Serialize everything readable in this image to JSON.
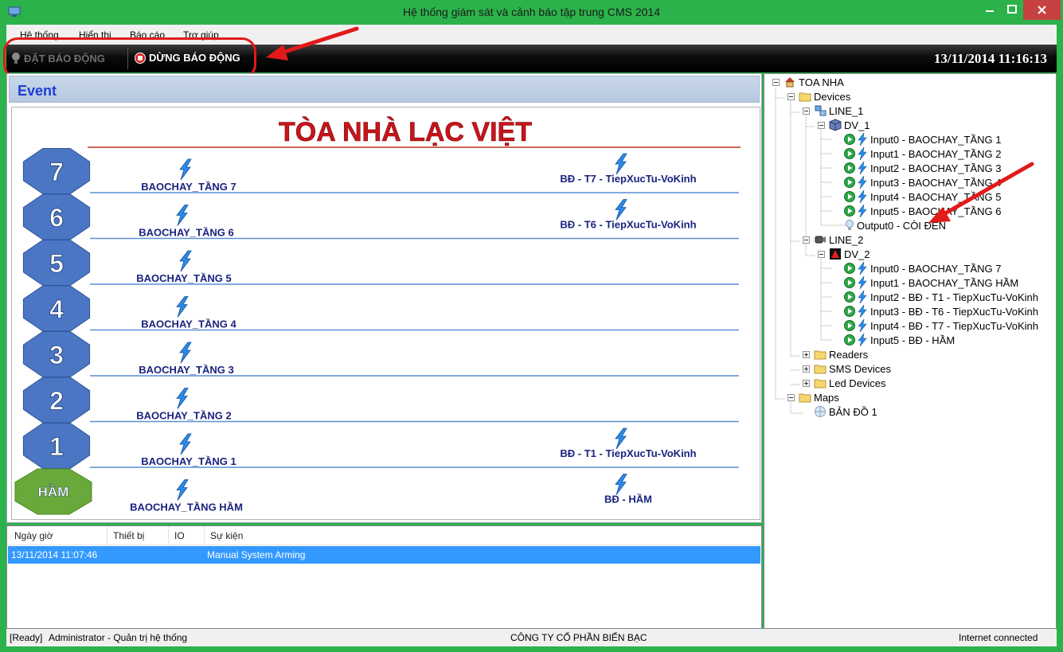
{
  "window": {
    "title": "Hệ thống giám sát và cảnh báo tập trung CMS 2014"
  },
  "menu": {
    "items": [
      "Hệ thống",
      "Hiển thị",
      "Báo cáo",
      "Trợ giúp"
    ]
  },
  "toolbar": {
    "arm_label": "ĐẶT BÁO ĐỘNG",
    "disarm_label": "DỪNG BÁO ĐỘNG",
    "datetime": "13/11/2014 11:16:13"
  },
  "event": {
    "title": "Event"
  },
  "map": {
    "building_title": "TÒA NHÀ LẠC VIỆT",
    "floors": [
      {
        "badge": "7",
        "zone_label": "BAOCHAY_TẦNG 7",
        "extra_label": "BĐ - T7 - TiepXucTu-VoKinh"
      },
      {
        "badge": "6",
        "zone_label": "BAOCHAY_TẦNG 6",
        "extra_label": "BĐ - T6 - TiepXucTu-VoKinh"
      },
      {
        "badge": "5",
        "zone_label": "BAOCHAY_TẦNG 5",
        "extra_label": ""
      },
      {
        "badge": "4",
        "zone_label": "BAOCHAY_TẦNG 4",
        "extra_label": ""
      },
      {
        "badge": "3",
        "zone_label": "BAOCHAY_TẦNG 3",
        "extra_label": ""
      },
      {
        "badge": "2",
        "zone_label": "BAOCHAY_TẦNG 2",
        "extra_label": ""
      },
      {
        "badge": "1",
        "zone_label": "BAOCHAY_TẦNG 1",
        "extra_label": "BĐ - T1 - TiepXucTu-VoKinh"
      },
      {
        "badge": "HẦM",
        "zone_label": "BAOCHAY_TẦNG HẦM",
        "extra_label": "BĐ - HẦM"
      }
    ]
  },
  "events_table": {
    "columns": [
      "Ngày giờ",
      "Thiết bị",
      "IO",
      "Sự kiện"
    ],
    "rows": [
      {
        "datetime": "13/11/2014 11:07:46",
        "device": "",
        "io": "",
        "event": "Manual System Arming"
      }
    ]
  },
  "tree": {
    "root": "TOA NHA",
    "devices": "Devices",
    "line1": "LINE_1",
    "dv1": "DV_1",
    "dv1_items": [
      "Input0 - BAOCHAY_TẦNG 1",
      "Input1 - BAOCHAY_TẦNG 2",
      "Input2 - BAOCHAY_TẦNG 3",
      "Input3 - BAOCHAY_TẦNG 4",
      "Input4 - BAOCHAY_TẦNG 5",
      "Input5 - BAOCHAY_TẦNG 6"
    ],
    "dv1_output": "Output0 - CÒI ĐÈN",
    "line2": "LINE_2",
    "dv2": "DV_2",
    "dv2_items": [
      "Input0 - BAOCHAY_TẦNG 7",
      "Input1 - BAOCHAY_TẦNG HẦM",
      "Input2 - BĐ - T1 - TiepXucTu-VoKinh",
      "Input3 - BĐ - T6 - TiepXucTu-VoKinh",
      "Input4 - BĐ - T7 - TiepXucTu-VoKinh",
      "Input5 - BĐ - HẦM"
    ],
    "readers": "Readers",
    "sms": "SMS Devices",
    "led": "Led Devices",
    "maps": "Maps",
    "map1": "BẢN ĐỒ 1"
  },
  "status": {
    "ready": "[Ready]",
    "user": "Administrator - Quản trị hệ thống",
    "company": "CÔNG TY CỔ PHẦN BIỂN BẠC",
    "network": "Internet connected"
  },
  "colors": {
    "title_bar": "#2bb24a",
    "close_button": "#c74141",
    "event_title": "#1d3fd4",
    "building_title": "#c8141b",
    "floor_badge": "#4a76c4",
    "basement_badge": "#69a83a",
    "floor_line": "#5b8fd6",
    "zone_label": "#1a237e",
    "selection": "#3399ff",
    "callout": "#e21a1a"
  },
  "icons": {
    "zone": "lightning-bolt-icon",
    "input": "green-play-icon",
    "output": "light-bulb-icon",
    "folder": "folder-icon"
  }
}
